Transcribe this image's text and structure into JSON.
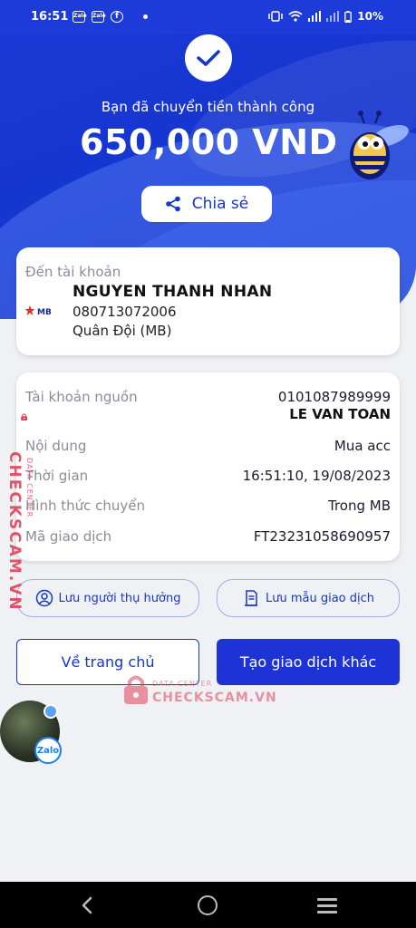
{
  "status_bar": {
    "time": "16:51",
    "notification_icons": [
      "Zalo",
      "Zalo",
      "f"
    ],
    "battery": "10%"
  },
  "hero": {
    "success_message": "Bạn đã chuyển tiền thành công",
    "amount": "650,000 VND",
    "share_label": "Chia sẻ"
  },
  "recipient": {
    "label": "Đến tài khoản",
    "bank_logo": "MB",
    "name": "NGUYEN THANH NHAN",
    "account_number": "080713072006",
    "bank_name": "Quân Đội (MB)"
  },
  "details": {
    "source_label": "Tài khoản nguồn",
    "source_account": "0101087989999",
    "source_name": "LE VAN TOAN",
    "content_label": "Nội dung",
    "content_value": "Mua acc",
    "time_label": "Thời gian",
    "time_value": "16:51:10, 19/08/2023",
    "method_label": "Hình thức chuyển",
    "method_value": "Trong MB",
    "code_label": "Mã giao dịch",
    "code_value": "FT23231058690957"
  },
  "actions": {
    "save_beneficiary": "Lưu người thụ hưởng",
    "save_template": "Lưu mẫu giao dịch",
    "home": "Về trang chủ",
    "new_transaction": "Tạo giao dịch khác"
  },
  "watermark": {
    "brand": "CHECKSCAM.VN",
    "sub": "DATA CENTER"
  },
  "zalo_bubble": {
    "label": "Zalo"
  },
  "colors": {
    "primary": "#1535cf",
    "watermark": "#e0425a"
  }
}
